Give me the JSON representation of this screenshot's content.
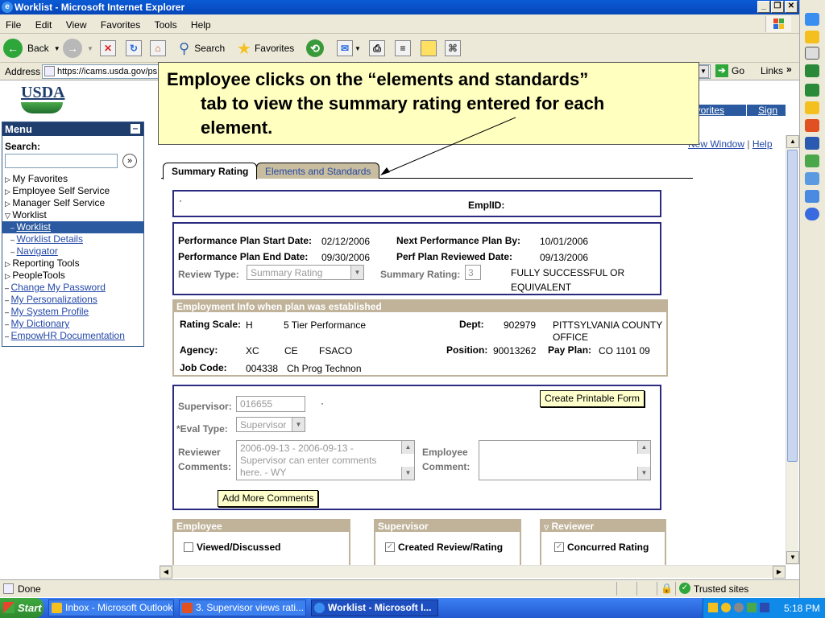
{
  "window": {
    "title": "Worklist - Microsoft Internet Explorer"
  },
  "menubar": [
    "File",
    "Edit",
    "View",
    "Favorites",
    "Tools",
    "Help"
  ],
  "toolbar": {
    "back": "Back",
    "search": "Search",
    "favorites": "Favorites"
  },
  "address": {
    "label": "Address",
    "url": "https://icams.usda.gov/ps",
    "go": "Go",
    "links": "Links"
  },
  "callout": {
    "line1": "Employee clicks on the  “elements and standards”",
    "line2": "tab to view  the summary rating entered for each",
    "line3": "element."
  },
  "logo": "USDA",
  "topnav": {
    "favorites": "avorites",
    "signout": "Sign out",
    "new_window": "New Window",
    "help": "Help"
  },
  "menu": {
    "title": "Menu",
    "search_label": "Search:",
    "items": [
      {
        "label": "My Favorites",
        "type": "folder"
      },
      {
        "label": "Employee Self Service",
        "type": "folder"
      },
      {
        "label": "Manager Self Service",
        "type": "folder"
      },
      {
        "label": "Worklist",
        "type": "open"
      },
      {
        "label": "Worklist",
        "type": "selected"
      },
      {
        "label": "Worklist Details",
        "type": "sublink"
      },
      {
        "label": "Navigator",
        "type": "sublink"
      },
      {
        "label": "Reporting Tools",
        "type": "folder"
      },
      {
        "label": "PeopleTools",
        "type": "folder"
      },
      {
        "label": "Change My Password",
        "type": "link"
      },
      {
        "label": "My Personalizations",
        "type": "link"
      },
      {
        "label": "My System Profile",
        "type": "link"
      },
      {
        "label": "My Dictionary",
        "type": "link"
      },
      {
        "label": "EmpowHR Documentation",
        "type": "link"
      }
    ]
  },
  "tabs": {
    "summary": "Summary Rating",
    "elements": "Elements and Standards"
  },
  "header_box": {
    "dot": "·",
    "emplid_label": "EmplID:"
  },
  "plan": {
    "start_label": "Performance Plan Start Date:",
    "start_value": "02/12/2006",
    "end_label": "Performance Plan End Date:",
    "end_value": "09/30/2006",
    "next_label": "Next Performance Plan By:",
    "next_value": "10/01/2006",
    "reviewed_label": "Perf Plan Reviewed Date:",
    "reviewed_value": "09/13/2006",
    "review_type_label": "Review Type:",
    "review_type_value": "Summary Rating",
    "summary_rating_label": "Summary Rating:",
    "summary_rating_value": "3",
    "rating_desc1": "FULLY SUCCESSFUL OR",
    "rating_desc2": "EQUIVALENT"
  },
  "employment": {
    "header": "Employment Info when plan was established",
    "rating_scale_label": "Rating Scale:",
    "rating_scale_code": "H",
    "rating_scale_desc": "5 Tier Performance",
    "dept_label": "Dept:",
    "dept_code": "902979",
    "dept_name1": "PITTSYLVANIA COUNTY",
    "dept_name2": "OFFICE",
    "agency_label": "Agency:",
    "agency_code": "XC",
    "agency_sub": "CE",
    "agency_org": "FSACO",
    "position_label": "Position:",
    "position_value": "90013262",
    "payplan_label": "Pay Plan:",
    "payplan_value": "CO  1101  09",
    "jobcode_label": "Job Code:",
    "jobcode_value": "004338",
    "jobcode_desc": "Ch Prog Technon"
  },
  "eval": {
    "supervisor_label": "Supervisor:",
    "supervisor_value": "016655",
    "supervisor_dot": "·",
    "create_btn": "Create Printable Form",
    "eval_type_label": "*Eval Type:",
    "eval_type_value": "Supervisor",
    "reviewer_label1": "Reviewer",
    "reviewer_label2": "Comments:",
    "reviewer_text1": "2006-09-13 - 2006-09-13 -",
    "reviewer_text2": "Supervisor can enter comments",
    "reviewer_text3": "here. - WY",
    "employee_label1": "Employee",
    "employee_label2": "Comment:",
    "add_btn": "Add More Comments"
  },
  "signoff": {
    "employee_header": "Employee",
    "employee_check": "Viewed/Discussed",
    "supervisor_header": "Supervisor",
    "supervisor_check": "Created Review/Rating",
    "reviewer_header": "Reviewer",
    "reviewer_check": "Concurred Rating"
  },
  "status": {
    "text": "Done",
    "zone": "Trusted sites"
  },
  "taskbar": {
    "start": "Start",
    "tasks": [
      "Inbox - Microsoft Outlook",
      "3.  Supervisor views rati...",
      "Worklist - Microsoft I..."
    ],
    "clock": "5:18 PM"
  }
}
